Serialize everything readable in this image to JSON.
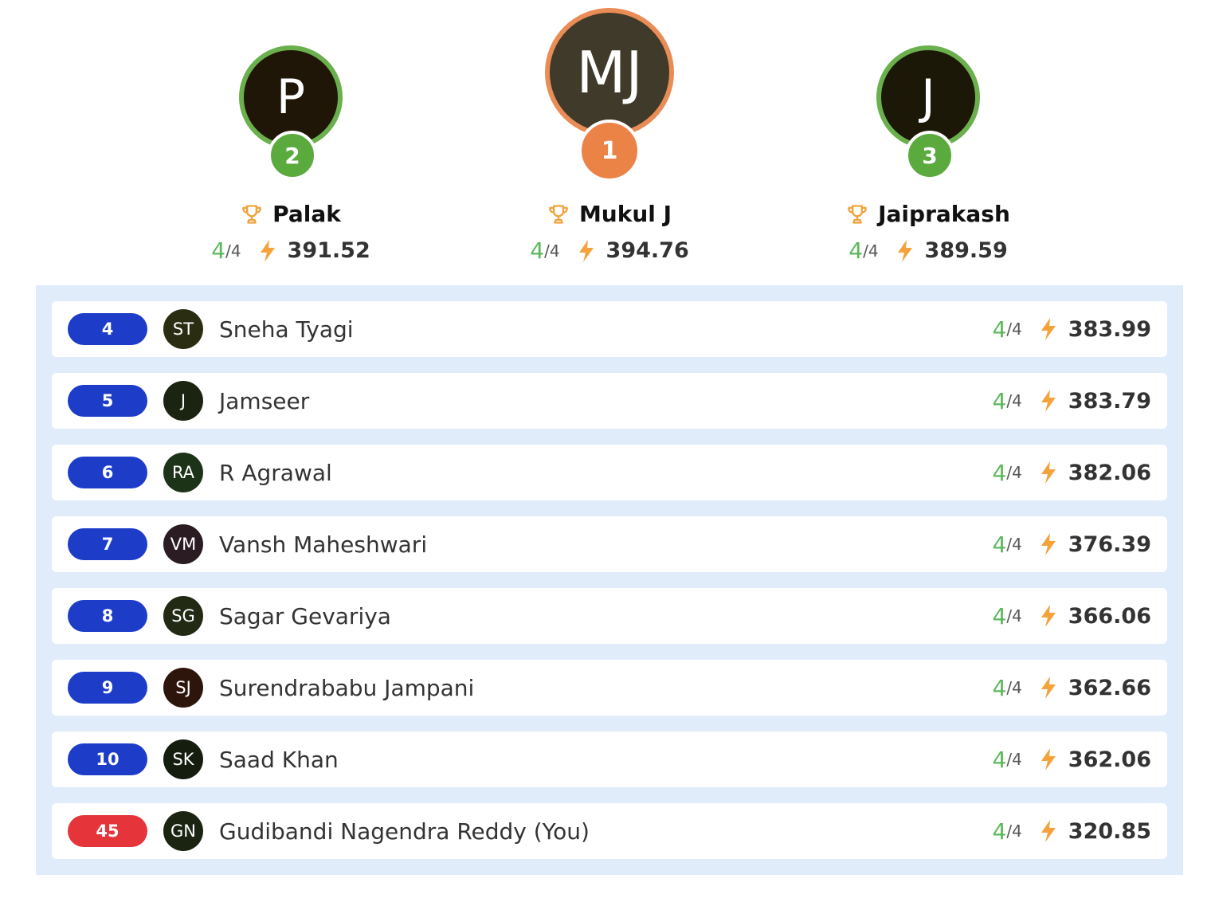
{
  "podium": [
    {
      "rank": "2",
      "initials": "P",
      "name": "Palak",
      "solved": "4",
      "total": "/4",
      "score": "391.52",
      "avatar_color": "#201607",
      "ring_color": "#6ab04c",
      "medal_color": "#5aaa3e"
    },
    {
      "rank": "1",
      "initials": "MJ",
      "name": "Mukul J",
      "solved": "4",
      "total": "/4",
      "score": "394.76",
      "avatar_color": "#3f3a2a",
      "ring_color": "#ea8c55",
      "medal_color": "#ec8346"
    },
    {
      "rank": "3",
      "initials": "J",
      "name": "Jaiprakash",
      "solved": "4",
      "total": "/4",
      "score": "389.59",
      "avatar_color": "#1c1807",
      "ring_color": "#6ab04c",
      "medal_color": "#5aaa3e"
    }
  ],
  "rows": [
    {
      "rank": "4",
      "initials": "ST",
      "name": "Sneha Tyagi",
      "solved": "4",
      "total": "/4",
      "score": "383.99",
      "avatar_color": "#2b2d12",
      "pill_color": "#1d3dc9"
    },
    {
      "rank": "5",
      "initials": "J",
      "name": "Jamseer",
      "solved": "4",
      "total": "/4",
      "score": "383.79",
      "avatar_color": "#1a2410",
      "pill_color": "#1d3dc9"
    },
    {
      "rank": "6",
      "initials": "RA",
      "name": "R Agrawal",
      "solved": "4",
      "total": "/4",
      "score": "382.06",
      "avatar_color": "#1d3318",
      "pill_color": "#1d3dc9"
    },
    {
      "rank": "7",
      "initials": "VM",
      "name": "Vansh Maheshwari",
      "solved": "4",
      "total": "/4",
      "score": "376.39",
      "avatar_color": "#2a1c22",
      "pill_color": "#1d3dc9"
    },
    {
      "rank": "8",
      "initials": "SG",
      "name": "Sagar Gevariya",
      "solved": "4",
      "total": "/4",
      "score": "366.06",
      "avatar_color": "#222a14",
      "pill_color": "#1d3dc9"
    },
    {
      "rank": "9",
      "initials": "SJ",
      "name": "Surendrababu Jampani",
      "solved": "4",
      "total": "/4",
      "score": "362.66",
      "avatar_color": "#2e150c",
      "pill_color": "#1d3dc9"
    },
    {
      "rank": "10",
      "initials": "SK",
      "name": "Saad Khan",
      "solved": "4",
      "total": "/4",
      "score": "362.06",
      "avatar_color": "#141d0e",
      "pill_color": "#1d3dc9"
    },
    {
      "rank": "45",
      "initials": "GN",
      "name": "Gudibandi Nagendra Reddy (You)",
      "solved": "4",
      "total": "/4",
      "score": "320.85",
      "avatar_color": "#1a2410",
      "pill_color": "#e5343a"
    }
  ],
  "icons": {
    "trophy": "trophy-icon",
    "bolt": "lightning-bolt-icon"
  },
  "colors": {
    "solved": "#5cb85c",
    "bolt": "#f5a23b",
    "trophy": "#f0a33c",
    "list_bg": "#e1ecfb"
  }
}
